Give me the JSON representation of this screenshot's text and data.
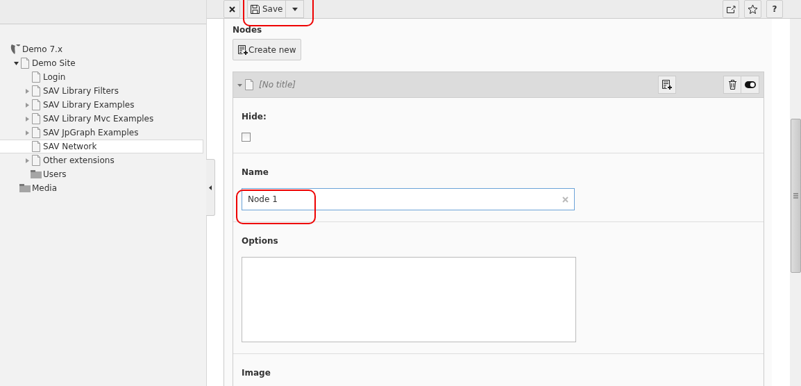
{
  "tree": [
    {
      "label": "Demo 7.x",
      "kind": "root",
      "selected": false,
      "children": [
        {
          "label": "Demo Site",
          "kind": "page",
          "expanded": true,
          "selected": false,
          "children": [
            {
              "label": "Login",
              "kind": "page",
              "selected": false
            },
            {
              "label": "SAV Library Filters",
              "kind": "page",
              "expanded": false,
              "selected": false
            },
            {
              "label": "SAV Library Examples",
              "kind": "page",
              "expanded": false,
              "selected": false
            },
            {
              "label": "SAV Library Mvc Examples",
              "kind": "page",
              "expanded": false,
              "selected": false
            },
            {
              "label": "SAV JpGraph Examples",
              "kind": "page",
              "expanded": false,
              "selected": false
            },
            {
              "label": "SAV Network",
              "kind": "page",
              "selected": true
            },
            {
              "label": "Other extensions",
              "kind": "page",
              "expanded": false,
              "selected": false
            },
            {
              "label": "Users",
              "kind": "folder",
              "selected": false
            }
          ]
        },
        {
          "label": "Media",
          "kind": "folder",
          "selected": false
        }
      ]
    }
  ],
  "toolbar": {
    "save": "Save",
    "help": "?"
  },
  "nodes": {
    "label": "Nodes",
    "create_button": "Create new",
    "record": {
      "title": "[No title]",
      "expanded": true,
      "fields": [
        {
          "kind": "checkbox",
          "label": "Hide:",
          "checked": false
        },
        {
          "kind": "text",
          "label": "Name",
          "value": "Node 1"
        },
        {
          "kind": "textarea",
          "label": "Options"
        },
        {
          "kind": "image",
          "label": "Image"
        }
      ]
    }
  }
}
